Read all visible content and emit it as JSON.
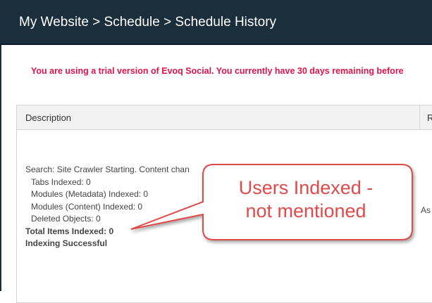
{
  "header": {
    "breadcrumb": "My Website > Schedule > Schedule History"
  },
  "notice": {
    "trial_message": "You are using a trial version of Evoq Social. You currently have 30 days remaining before"
  },
  "table": {
    "columns": [
      "Description",
      "R"
    ],
    "rows": [
      {
        "description_lines": [
          "Search: Site Crawler Starting. Content chan",
          "Tabs Indexed: 0",
          "Modules (Metadata) Indexed: 0",
          "Modules (Content) Indexed: 0",
          "Deleted Objects: 0",
          "Total Items Indexed: 0",
          "Indexing Successful"
        ],
        "col2_partial": "As"
      }
    ]
  },
  "annotation": {
    "line1": "Users Indexed -",
    "line2": "not mentioned",
    "color": "#e04a4a"
  },
  "colors": {
    "header_bg": "#1b2e3b",
    "trial_text": "#e0134b"
  }
}
